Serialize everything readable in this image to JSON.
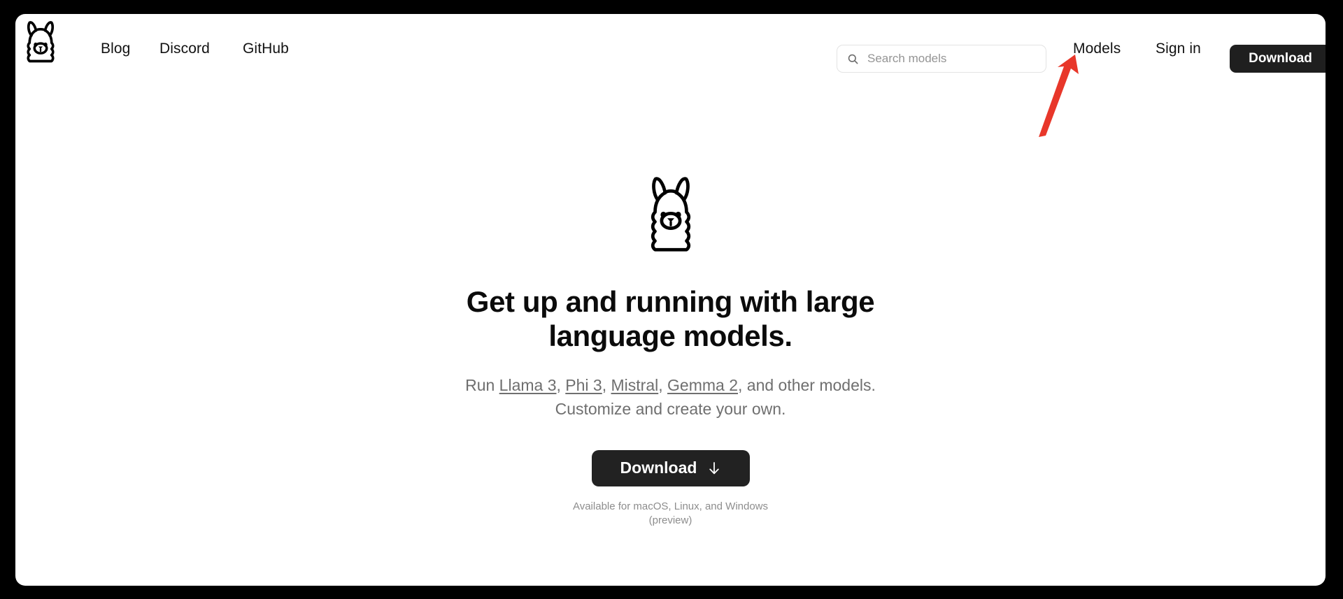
{
  "window": {
    "background_color": "#000000",
    "panel_color": "#ffffff"
  },
  "navbar": {
    "logo_icon": "llama-logo-icon",
    "links": [
      {
        "label": "Blog"
      },
      {
        "label": "Discord"
      },
      {
        "label": "GitHub"
      }
    ],
    "search": {
      "icon": "search-icon",
      "placeholder": "Search models",
      "value": ""
    },
    "models_label": "Models",
    "signin_label": "Sign in",
    "download_label": "Download",
    "download_button_color": "#1f1f1f"
  },
  "hero": {
    "logo_icon": "llama-logo-icon",
    "title": "Get up and running with large language models.",
    "subtitle": {
      "prefix": "Run ",
      "links": [
        {
          "label": "Llama 3"
        },
        {
          "label": "Phi 3"
        },
        {
          "label": "Mistral"
        },
        {
          "label": "Gemma 2"
        }
      ],
      "separator": ", ",
      "suffix": ", and other models. Customize and create your own."
    },
    "download_label": "Download",
    "download_icon": "download-arrow-icon",
    "download_button_color": "#222222",
    "availability": "Available for macOS, Linux, and Windows (preview)"
  },
  "annotation": {
    "type": "arrow",
    "color": "#e8372a",
    "points_to": "Models",
    "direction": "up-right"
  }
}
